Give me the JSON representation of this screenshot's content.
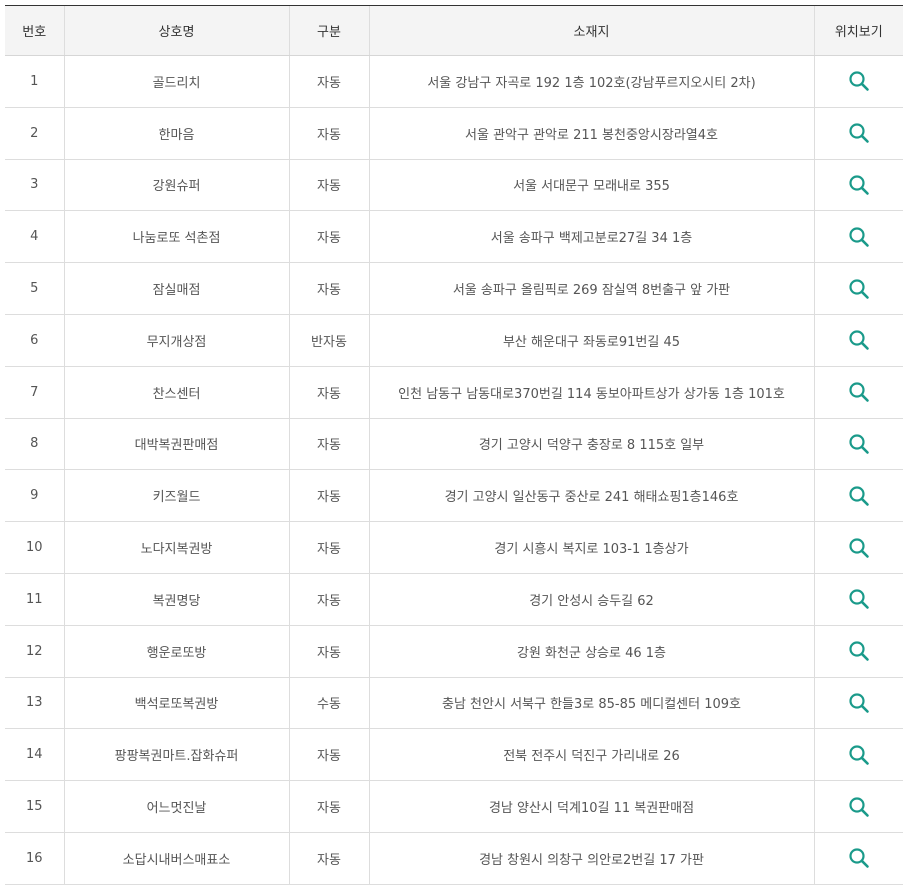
{
  "table": {
    "headers": {
      "no": "번호",
      "name": "상호명",
      "type": "구분",
      "address": "소재지",
      "map": "위치보기"
    },
    "rows": [
      {
        "no": "1",
        "name": "골드리치",
        "type": "자동",
        "address": "서울 강남구 자곡로 192 1층 102호(강남푸르지오시티 2차)"
      },
      {
        "no": "2",
        "name": "한마음",
        "type": "자동",
        "address": "서울 관악구 관악로 211 봉천중앙시장라열4호"
      },
      {
        "no": "3",
        "name": "강원슈퍼",
        "type": "자동",
        "address": "서울 서대문구 모래내로 355"
      },
      {
        "no": "4",
        "name": "나눔로또 석촌점",
        "type": "자동",
        "address": "서울 송파구 백제고분로27길 34 1층"
      },
      {
        "no": "5",
        "name": "잠실매점",
        "type": "자동",
        "address": "서울 송파구 올림픽로 269 잠실역 8번출구 앞 가판"
      },
      {
        "no": "6",
        "name": "무지개상점",
        "type": "반자동",
        "address": "부산 해운대구 좌동로91번길 45"
      },
      {
        "no": "7",
        "name": "찬스센터",
        "type": "자동",
        "address": "인천 남동구 남동대로370번길 114 동보아파트상가 상가동 1층 101호"
      },
      {
        "no": "8",
        "name": "대박복권판매점",
        "type": "자동",
        "address": "경기 고양시 덕양구 충장로 8 115호 일부"
      },
      {
        "no": "9",
        "name": "키즈월드",
        "type": "자동",
        "address": "경기 고양시 일산동구 중산로 241 해태쇼핑1층146호"
      },
      {
        "no": "10",
        "name": "노다지복권방",
        "type": "자동",
        "address": "경기 시흥시 복지로 103-1 1층상가"
      },
      {
        "no": "11",
        "name": "복권명당",
        "type": "자동",
        "address": "경기 안성시 승두길 62"
      },
      {
        "no": "12",
        "name": "행운로또방",
        "type": "자동",
        "address": "강원 화천군 상승로 46 1층"
      },
      {
        "no": "13",
        "name": "백석로또복권방",
        "type": "수동",
        "address": "충남 천안시 서북구 한들3로 85-85 메디컬센터 109호"
      },
      {
        "no": "14",
        "name": "팡팡복권마트.잡화슈퍼",
        "type": "자동",
        "address": "전북 전주시 덕진구 가리내로 26"
      },
      {
        "no": "15",
        "name": "어느멋진날",
        "type": "자동",
        "address": "경남 양산시 덕계10길 11 복권판매점"
      },
      {
        "no": "16",
        "name": "소답시내버스매표소",
        "type": "자동",
        "address": "경남 창원시 의창구 의안로2번길 17 가판"
      }
    ]
  },
  "icons": {
    "map": "search-icon",
    "map_color": "#1a9a8a"
  }
}
